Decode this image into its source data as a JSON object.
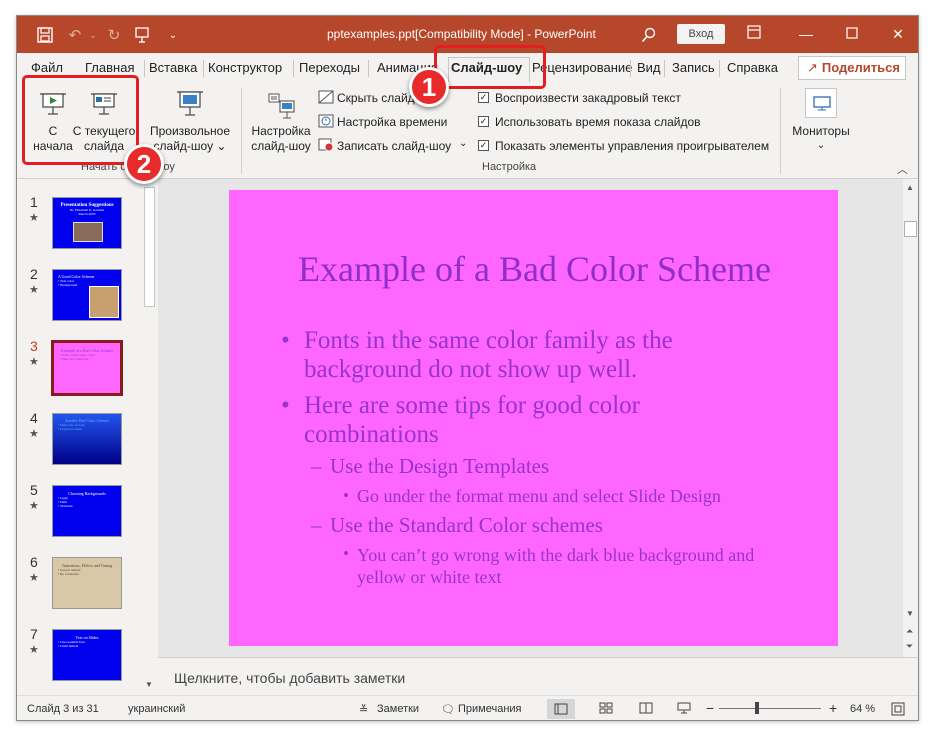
{
  "title": "pptexamples.ppt[Compatibility Mode]  -  PowerPoint",
  "signin_label": "Вход",
  "tabs": [
    "Файл",
    "Главная",
    "Вставка",
    "Конструктор",
    "Переходы",
    "Анимация",
    "Слайд-шоу",
    "Рецензирование",
    "Вид",
    "Запись",
    "Справка"
  ],
  "share_label": "Поделиться",
  "ribbon": {
    "from_beginning": [
      "С",
      "начала"
    ],
    "from_current": [
      "С текущего",
      "слайда"
    ],
    "custom_show": [
      "Произвольное",
      "слайд-шоу ⌄"
    ],
    "group_start": "Начать слайд-шоу",
    "setup_show": [
      "Настройка",
      "слайд-шоу"
    ],
    "hide_slide": "Скрыть слайд",
    "rehearse": "Настройка времени",
    "record": "Записать слайд-шоу",
    "play_narrations": "Воспроизвести закадровый текст",
    "use_timings": "Использовать время показа слайдов",
    "show_controls": "Показать элементы управления проигрывателем",
    "group_setup": "Настройка",
    "monitors": "Мониторы"
  },
  "thumbs": [
    {
      "num": "1",
      "title": "Presentation Suggestions",
      "sub": "Dr. Elizabeth E. Gardner\nMarch 2005"
    },
    {
      "num": "2",
      "title": "A Good Color Scheme",
      "sub": "• Text color\n• Background"
    },
    {
      "num": "3",
      "title": "Example of a Bad Color Scheme",
      "sub": "• Fonts in the same color\n• Here are some tips"
    },
    {
      "num": "4",
      "title": "Another Bad Color Scheme",
      "sub": "• Dark text on dark\n• Light text fades"
    },
    {
      "num": "5",
      "title": "Choosing Backgrounds",
      "sub": "• Light\n• Dark\n• Textured"
    },
    {
      "num": "6",
      "title": "Transitions, Effects and Timing",
      "sub": "• Keep it simple\n• Be consistent"
    },
    {
      "num": "7",
      "title": "Text on Slides",
      "sub": "• Use readable font\n• Limit bullets"
    }
  ],
  "slide": {
    "title": "Example of a Bad Color Scheme",
    "b1": "Fonts in the same color family as the background do not show up well.",
    "b2": "Here are some tips for good color combinations",
    "s1": "Use the Design Templates",
    "ss1": "Go under the format menu and select Slide Design",
    "s2": "Use the Standard Color schemes",
    "ss2": "You can’t go wrong with the dark blue background and yellow or white text"
  },
  "notes_placeholder": "Щелкните, чтобы добавить заметки",
  "status": {
    "slide_info": "Слайд 3 из 31",
    "language": "украинский",
    "notes": "Заметки",
    "comments": "Примечания",
    "zoom": "64 %"
  },
  "callouts": [
    "1",
    "2"
  ],
  "colors": {
    "accent": "#b7472a",
    "slide_bg": "#ff66ff",
    "slide_text": "#9933cc",
    "callout": "#e02020"
  }
}
